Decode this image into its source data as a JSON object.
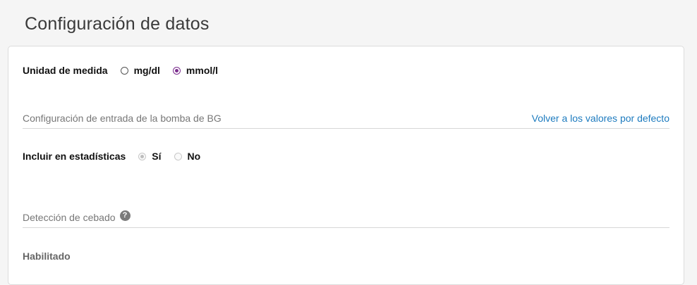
{
  "page": {
    "title": "Configuración de datos"
  },
  "units": {
    "label": "Unidad de medida",
    "options": [
      {
        "label": "mg/dl",
        "checked": false
      },
      {
        "label": "mmol/l",
        "checked": true
      }
    ]
  },
  "bg_section": {
    "title": "Configuración de entrada de la bomba de BG",
    "reset_link": "Volver a los valores por defecto"
  },
  "stats": {
    "label": "Incluir en estadísticas",
    "options": [
      {
        "label": "Sí",
        "checked": true,
        "disabled": true
      },
      {
        "label": "No",
        "checked": false,
        "disabled": true
      }
    ]
  },
  "priming_section": {
    "title": "Detección de cebado",
    "help_icon": "question-circle-icon"
  },
  "enabled": {
    "label": "Habilitado"
  },
  "colors": {
    "accent": "#7b2d8e",
    "link": "#1d7bbf"
  }
}
